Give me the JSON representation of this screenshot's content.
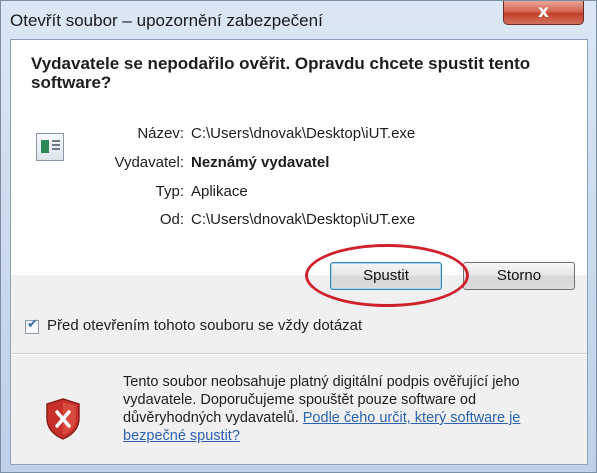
{
  "window": {
    "title": "Otevřít soubor – upozornění zabezpečení",
    "close_glyph": "x"
  },
  "headline": "Vydavatele se nepodařilo ověřit. Opravdu chcete spustit tento software?",
  "details": [
    {
      "label": "Název:",
      "value": "C:\\Users\\dnovak\\Desktop\\iUT.exe",
      "bold": false
    },
    {
      "label": "Vydavatel:",
      "value": "Neznámý vydavatel",
      "bold": true
    },
    {
      "label": "Typ:",
      "value": "Aplikace",
      "bold": false
    },
    {
      "label": "Od:",
      "value": "C:\\Users\\dnovak\\Desktop\\iUT.exe",
      "bold": false
    }
  ],
  "buttons": {
    "run": "Spustit",
    "cancel": "Storno"
  },
  "checkbox": {
    "label": "Před otevřením tohoto souboru se vždy dotázat",
    "checked": true
  },
  "warning": {
    "text": "Tento soubor neobsahuje platný digitální podpis ověřující jeho vydavatele. Doporučujeme spouštět pouze software od důvěryhodných vydavatelů.",
    "link": "Podle čeho určit, který software je bezpečné spustit?"
  },
  "icons": {
    "app": "application-file-icon",
    "shield": "security-shield-error-icon"
  },
  "colors": {
    "annotation_ellipse": "#d0202a",
    "link": "#2a63b0",
    "close_button": "#c1402a"
  }
}
